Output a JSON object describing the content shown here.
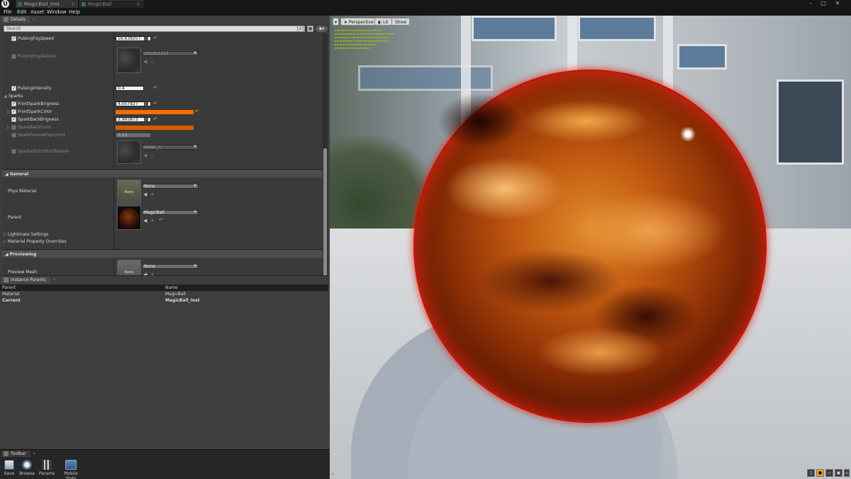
{
  "window": {
    "tabs": [
      {
        "label": "MagicBall_Inst"
      },
      {
        "label": "MagicBall"
      }
    ]
  },
  "menu": [
    "File",
    "Edit",
    "Asset",
    "Window",
    "Help"
  ],
  "details": {
    "tab_label": "Details",
    "search_placeholder": "Search",
    "params": [
      {
        "label": "PulsingFogSpeed",
        "value": "16.639257",
        "checked": true
      },
      {
        "label": "PulsingFogTexture",
        "value": "clouds1024",
        "checked": false
      },
      {
        "label": "PulsingIntensity",
        "value": "0.4",
        "checked": true
      }
    ],
    "sparks_group": "Sparks",
    "sparks": [
      {
        "label": "FrontSparkBrigness",
        "value": "4.057927",
        "checked": true
      },
      {
        "label": "FrontSparkColor",
        "checked": true
      },
      {
        "label": "SparkBackBrigness",
        "value": "2.965873",
        "checked": true
      },
      {
        "label": "SparkBackColor",
        "checked": false
      },
      {
        "label": "SparkFresnelExponent",
        "value": "0.15",
        "checked": false
      },
      {
        "label": "SparksDistortionTexture",
        "value": "water_n",
        "checked": false
      }
    ],
    "general": {
      "title": "General",
      "phys_label": "Phys Material",
      "phys_value": "None",
      "phys_thumb": "None",
      "parent_label": "Parent",
      "parent_value": "MagicBall",
      "lightmass": "Lightmass Settings",
      "overrides": "Material Property Overrides"
    },
    "previewing": {
      "title": "Previewing",
      "mesh_label": "Preview Mesh",
      "mesh_value": "None",
      "mesh_thumb": "None"
    }
  },
  "instance_parents": {
    "tab_label": "Instance Parents",
    "columns": [
      "Parent",
      "Name"
    ],
    "rows": [
      {
        "parent": "Material",
        "name": "MagicBall"
      },
      {
        "parent": "Current",
        "name": "MagicBall_Inst"
      }
    ]
  },
  "toolbar": {
    "tab_label": "Toolbar",
    "buttons": [
      "Save",
      "Browse",
      "Params",
      "Mobile Stats"
    ]
  },
  "viewport": {
    "perspective": "Perspective",
    "lit": "Lit",
    "show": "Show"
  },
  "colors": {
    "spark_color": "#ff6c00",
    "sphere_rim": "#c01508",
    "stats_text": "#9bbd1c"
  }
}
